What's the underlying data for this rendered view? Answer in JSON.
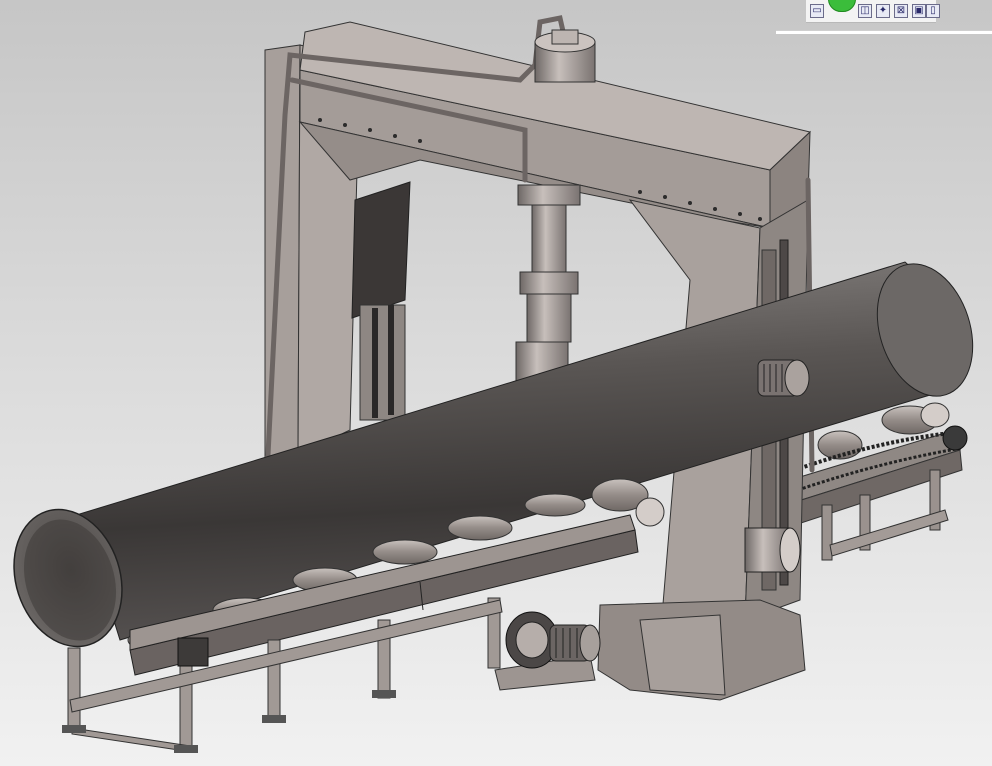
{
  "app": {
    "window_title": ""
  },
  "viewport": {
    "background_top": "#c6c6c6",
    "background_bottom": "#f1f1f1",
    "model_color": "#9f9793",
    "pipe_color": "#4a4745"
  },
  "toolbar": {
    "icons": [
      {
        "name": "sketch-icon",
        "glyph": "▭"
      },
      {
        "name": "view-orient-icon",
        "glyph": "◫"
      },
      {
        "name": "star-icon",
        "glyph": "✦"
      },
      {
        "name": "zoom-fit-icon",
        "glyph": "⊠"
      },
      {
        "name": "display-style-icon",
        "glyph": "▣"
      },
      {
        "name": "section-view-icon",
        "glyph": "▯"
      }
    ]
  }
}
